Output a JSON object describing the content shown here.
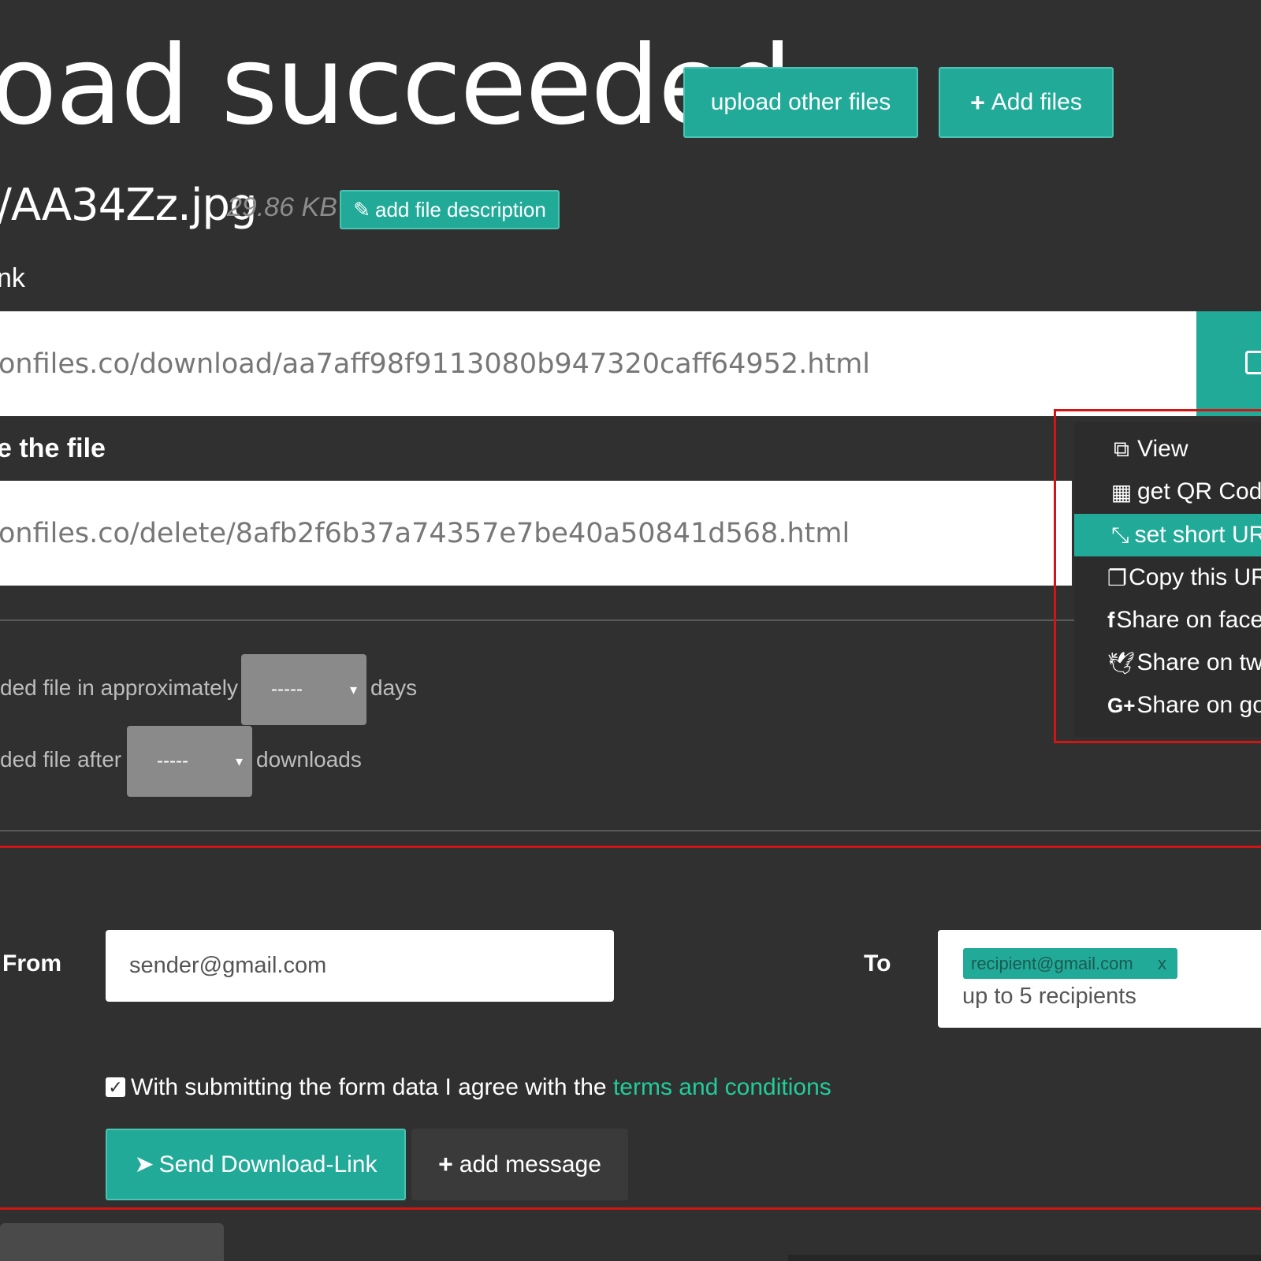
{
  "header": {
    "title": "oad succeeded",
    "upload_other_label": "upload other files",
    "add_files_label": "Add files"
  },
  "file": {
    "name": "/AA34Zz.jpg",
    "size": "29.86 KB",
    "add_description_label": "add file description"
  },
  "links": {
    "download_label": "nk",
    "download_url": "onfiles.co/download/aa7aff98f9113080b947320caff64952.html",
    "delete_label": "e the file",
    "delete_url": "onfiles.co/delete/8afb2f6b37a74357e7be40a50841d568.html"
  },
  "menu": {
    "items": [
      {
        "label": "View",
        "icon": "external-link-icon"
      },
      {
        "label": "get QR Code",
        "icon": "qr-code-icon"
      },
      {
        "label": "set short URL",
        "icon": "compress-icon",
        "active": true
      },
      {
        "label": "Copy this URL",
        "icon": "copy-icon"
      },
      {
        "label": "Share on facebook",
        "icon": "facebook-icon"
      },
      {
        "label": "Share on twitter",
        "icon": "twitter-icon"
      },
      {
        "label": "Share on google",
        "icon": "google-plus-icon"
      }
    ]
  },
  "settings": {
    "days_prefix": "ded file in approximately",
    "days_value": "-----",
    "days_suffix": "days",
    "downloads_prefix": "ded file after",
    "downloads_value": "-----",
    "downloads_suffix": "downloads"
  },
  "email": {
    "from_label": "From",
    "from_value": "sender@gmail.com",
    "to_label": "To",
    "recipient_tag": "recipient@gmail.com",
    "recipient_remove": "x",
    "to_placeholder": "up to 5 recipients",
    "agree_text": "With submitting the form data I agree with the ",
    "agree_link": "terms and conditions",
    "agree_checked": true,
    "send_label": "Send Download-Link",
    "add_message_label": "add message"
  },
  "colors": {
    "accent": "#22aa99",
    "background": "#303030",
    "highlight_red": "#d01515",
    "link_green": "#22cc9a"
  }
}
